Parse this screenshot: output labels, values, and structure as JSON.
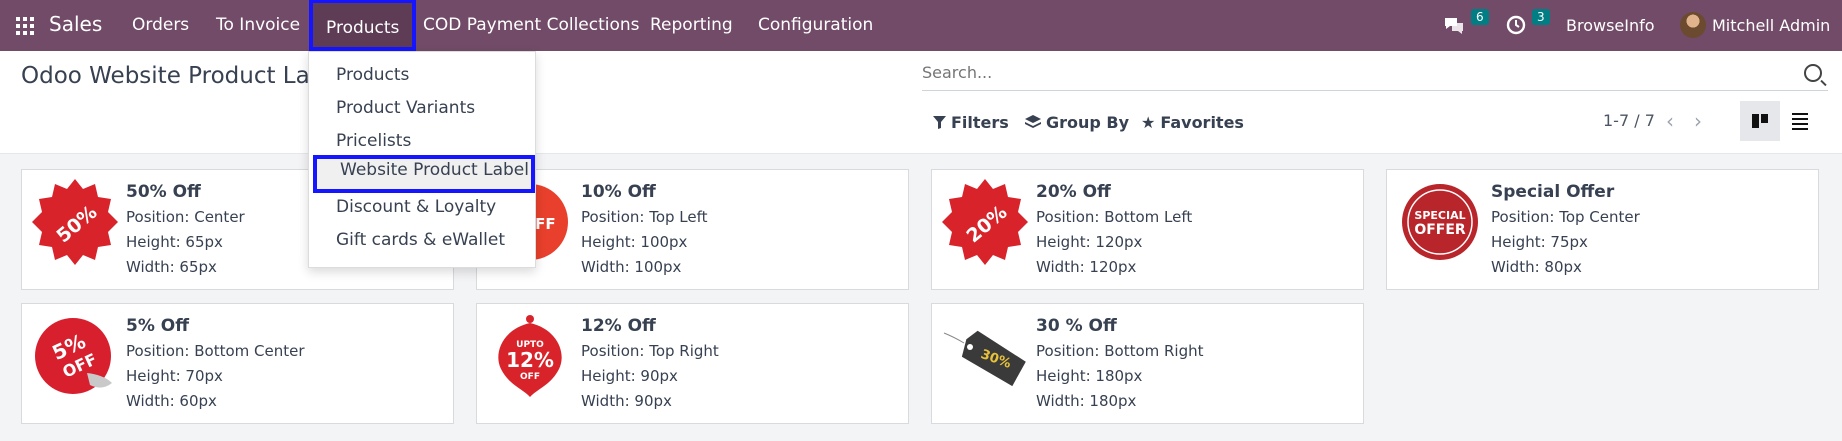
{
  "navbar": {
    "app_name": "Sales",
    "menu": [
      "Orders",
      "To Invoice",
      "Products",
      "COD Payment Collections",
      "Reporting",
      "Configuration"
    ],
    "active_menu": "Products",
    "messages_count": "6",
    "activities_count": "3",
    "company": "BrowseInfo",
    "user": "Mitchell Admin"
  },
  "control_panel": {
    "title": "Odoo Website Product Label",
    "search_placeholder": "Search...",
    "filters_label": "Filters",
    "group_by_label": "Group By",
    "favorites_label": "Favorites",
    "pager": "1-7 / 7",
    "view_mode": "kanban"
  },
  "products_dropdown": {
    "items": [
      "Products",
      "Product Variants",
      "Pricelists",
      "Website Product Label",
      "Discount & Loyalty",
      "Gift cards & eWallet"
    ],
    "highlighted": "Website Product Label"
  },
  "cards": [
    {
      "name": "50% Off",
      "position": "Position: Center",
      "height": "Height: 65px",
      "width": "Width: 65px",
      "icon": "starburst-50-off",
      "badge_text": "50% OFF",
      "color": "#d8232a"
    },
    {
      "name": "10% Off",
      "position": "Position: Top Left",
      "height": "Height: 100px",
      "width": "Width: 100px",
      "icon": "round-10-off",
      "badge_text": "OFF",
      "color": "#e8402c"
    },
    {
      "name": "20% Off",
      "position": "Position: Bottom Left",
      "height": "Height: 120px",
      "width": "Width: 120px",
      "icon": "starburst-20-off",
      "badge_text": "20% OFF",
      "color": "#d8232a"
    },
    {
      "name": "Special Offer",
      "position": "Position: Top Center",
      "height": "Height: 75px",
      "width": "Width: 80px",
      "icon": "seal-special-offer",
      "badge_text": "SPECIAL OFFER",
      "color": "#b8252b"
    },
    {
      "name": "5% Off",
      "position": "Position: Bottom Center",
      "height": "Height: 70px",
      "width": "Width: 60px",
      "icon": "sticker-5-off",
      "badge_text": "5% OFF",
      "color": "#d71f2d"
    },
    {
      "name": "12% Off",
      "position": "Position: Top Right",
      "height": "Height: 90px",
      "width": "Width: 90px",
      "icon": "ornament-12-off",
      "badge_text": "UPTO 12% OFF",
      "color": "#d8232a"
    },
    {
      "name": "30 % Off",
      "position": "Position: Bottom Right",
      "height": "Height: 180px",
      "width": "Width: 180px",
      "icon": "tag-30-off",
      "badge_text": "30% OFF",
      "color": "#3a3a3a"
    }
  ]
}
